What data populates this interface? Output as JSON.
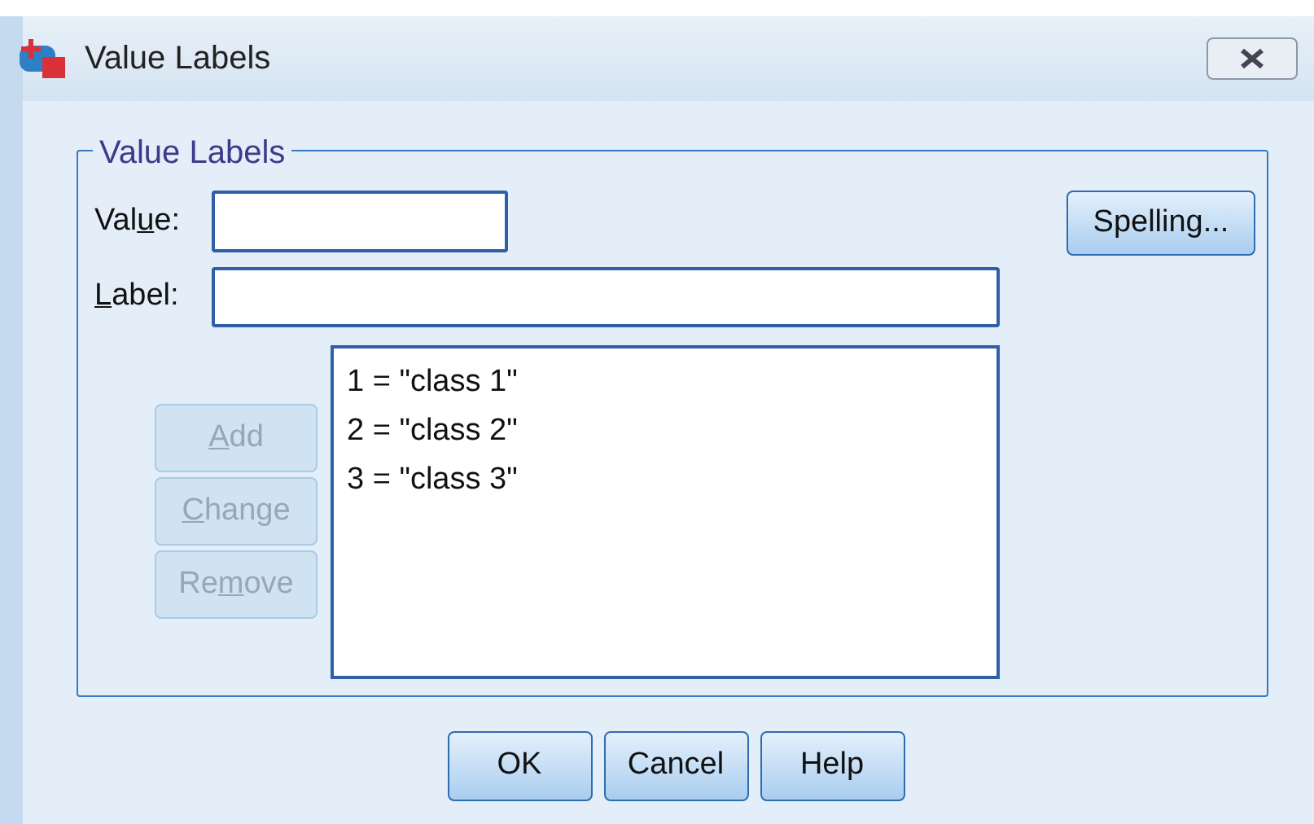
{
  "window": {
    "title": "Value Labels"
  },
  "group": {
    "title": "Value Labels"
  },
  "value_field": {
    "label": {
      "before": "Val",
      "key": "u",
      "after": "e:"
    }
  },
  "label_field": {
    "label": {
      "key": "L",
      "after": "abel:"
    }
  },
  "spelling_button": {
    "label": "Spelling...",
    "disabled": false
  },
  "side_buttons": [
    {
      "key": "A",
      "after": "dd",
      "disabled": true
    },
    {
      "key": "C",
      "after": "hange",
      "disabled": true
    },
    {
      "before": "Re",
      "key": "m",
      "after": "ove",
      "disabled": true
    }
  ],
  "list": {
    "items": [
      "1 = \"class 1\"",
      "2 = \"class 2\"",
      "3 = \"class 3\""
    ]
  },
  "buttons": [
    {
      "label": "OK",
      "disabled": false
    },
    {
      "label": "Cancel",
      "disabled": false
    },
    {
      "label": "Help",
      "disabled": false
    }
  ]
}
